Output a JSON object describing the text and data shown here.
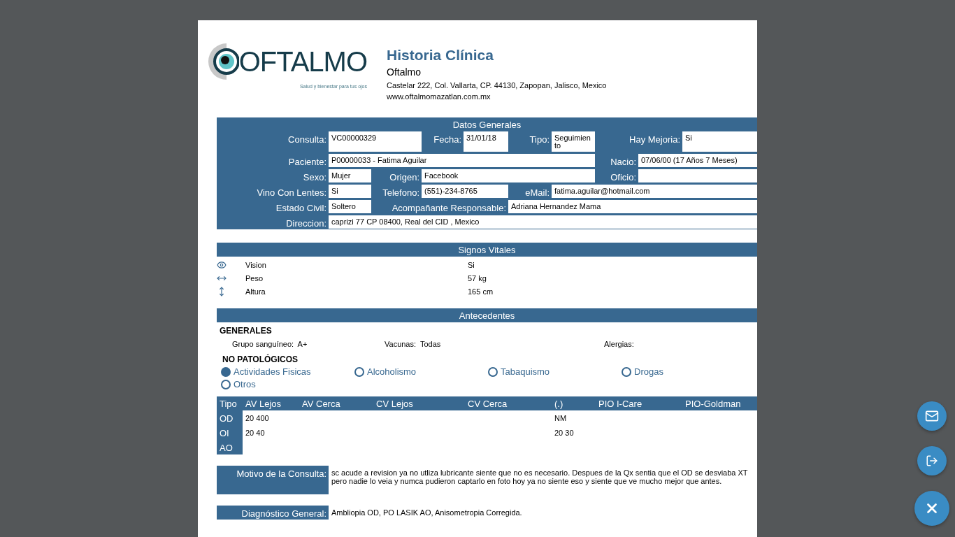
{
  "header": {
    "logo_word": "OFTALMO",
    "logo_tagline": "Salud y bienestar para tus ojos",
    "title": "Historia Clínica",
    "clinic": "Oftalmo",
    "address": "Castelar 222, Col. Vallarta, CP. 44130, Zapopan, Jalisco, Mexico",
    "website": "www.oftalmomazatlan.com.mx"
  },
  "datos_generales": {
    "title": "Datos Generales",
    "rows": [
      [
        {
          "label": "Consulta:",
          "value": "VC00000329"
        },
        {
          "label": "Fecha:",
          "value": "31/01/18"
        },
        {
          "label": "Tipo:",
          "value": "Seguimiento"
        },
        {
          "label": "Hay Mejoria:",
          "value": "Si"
        }
      ],
      [
        {
          "label": "Paciente:",
          "value": "P00000033 - Fatima Aguilar"
        },
        {},
        {},
        {
          "label": "Nacio:",
          "value": "07/06/00 (17 Años 7 Meses)"
        }
      ],
      [
        {
          "label": "Sexo:",
          "value": "Mujer"
        },
        {
          "label": "Origen:",
          "value": "Facebook"
        },
        {},
        {
          "label": "Oficio:"
        }
      ],
      [
        {
          "label": "Vino Con Lentes:",
          "value": "Si"
        },
        {
          "label": "Telefono:",
          "value": "(551)-234-8765"
        },
        {
          "label": "eMail:",
          "value": "fatima.aguilar@hotmail.com"
        }
      ],
      [
        {
          "label": "Estado Civil:",
          "value": "Soltero"
        },
        {
          "label": "Acompañante Responsable:",
          "value": "Adriana Hernandez  Mama"
        }
      ],
      [
        {
          "label": "Direccion:",
          "value": "caprizi 77 CP 08400, Real del CID , Mexico"
        }
      ]
    ]
  },
  "signos_vitales": {
    "title": "Signos Vitales",
    "items": [
      {
        "kind": "eye",
        "label": "Vision",
        "value": "Si"
      },
      {
        "kind": "horizontal",
        "label": "Peso",
        "value": "57 kg"
      },
      {
        "kind": "vertical",
        "label": "Altura",
        "value": "165 cm"
      }
    ]
  },
  "antecedentes": {
    "title": "Antecedentes",
    "generales_title": "GENERALES",
    "generales": [
      {
        "label": "Grupo sanguíneo:",
        "value": "A+"
      },
      {
        "label": "Vacunas:",
        "value": "Todas"
      },
      {
        "label": "Alergias:"
      }
    ],
    "no_patologicos_title": "NO PATOLÓGICOS",
    "no_patologicos": [
      {
        "label": "Actividades Fisicas",
        "selected": true
      },
      {
        "label": "Alcoholismo",
        "selected": false
      },
      {
        "label": "Tabaquismo",
        "selected": false
      },
      {
        "label": "Drogas",
        "selected": false
      },
      {
        "label": "Otros",
        "selected": false
      }
    ]
  },
  "vision_table": {
    "columns": [
      "Tipo",
      "AV Lejos",
      "AV Cerca",
      "CV Lejos",
      "CV Cerca",
      "(.)",
      "PIO I-Care",
      "PIO-Goldman"
    ],
    "rows": [
      [
        "OD",
        "20 400",
        "",
        "",
        "",
        "NM",
        "",
        ""
      ],
      [
        "OI",
        "20 40",
        "",
        "",
        "",
        "20 30",
        "",
        ""
      ],
      [
        "AO",
        "",
        "",
        "",
        "",
        "",
        "",
        ""
      ]
    ]
  },
  "motivo": {
    "label": "Motivo de la Consulta:",
    "value": "sc acude a revision  ya no utliza lubricante  siente que no es necesario. Despues de la Qx sentia que el OD se desviaba XT  pero nadie lo veia y numca pudieron captarlo en foto  hoy ya no siente eso  y siente que ve mucho mejor que antes."
  },
  "diagnostico": {
    "label": "Diagnóstico General:",
    "value": "Ambliopia OD, PO LASIK AO, Anisometropia Corregida."
  },
  "fab_buttons": [
    {
      "kind": "mail"
    },
    {
      "kind": "logout"
    },
    {
      "kind": "close"
    }
  ]
}
